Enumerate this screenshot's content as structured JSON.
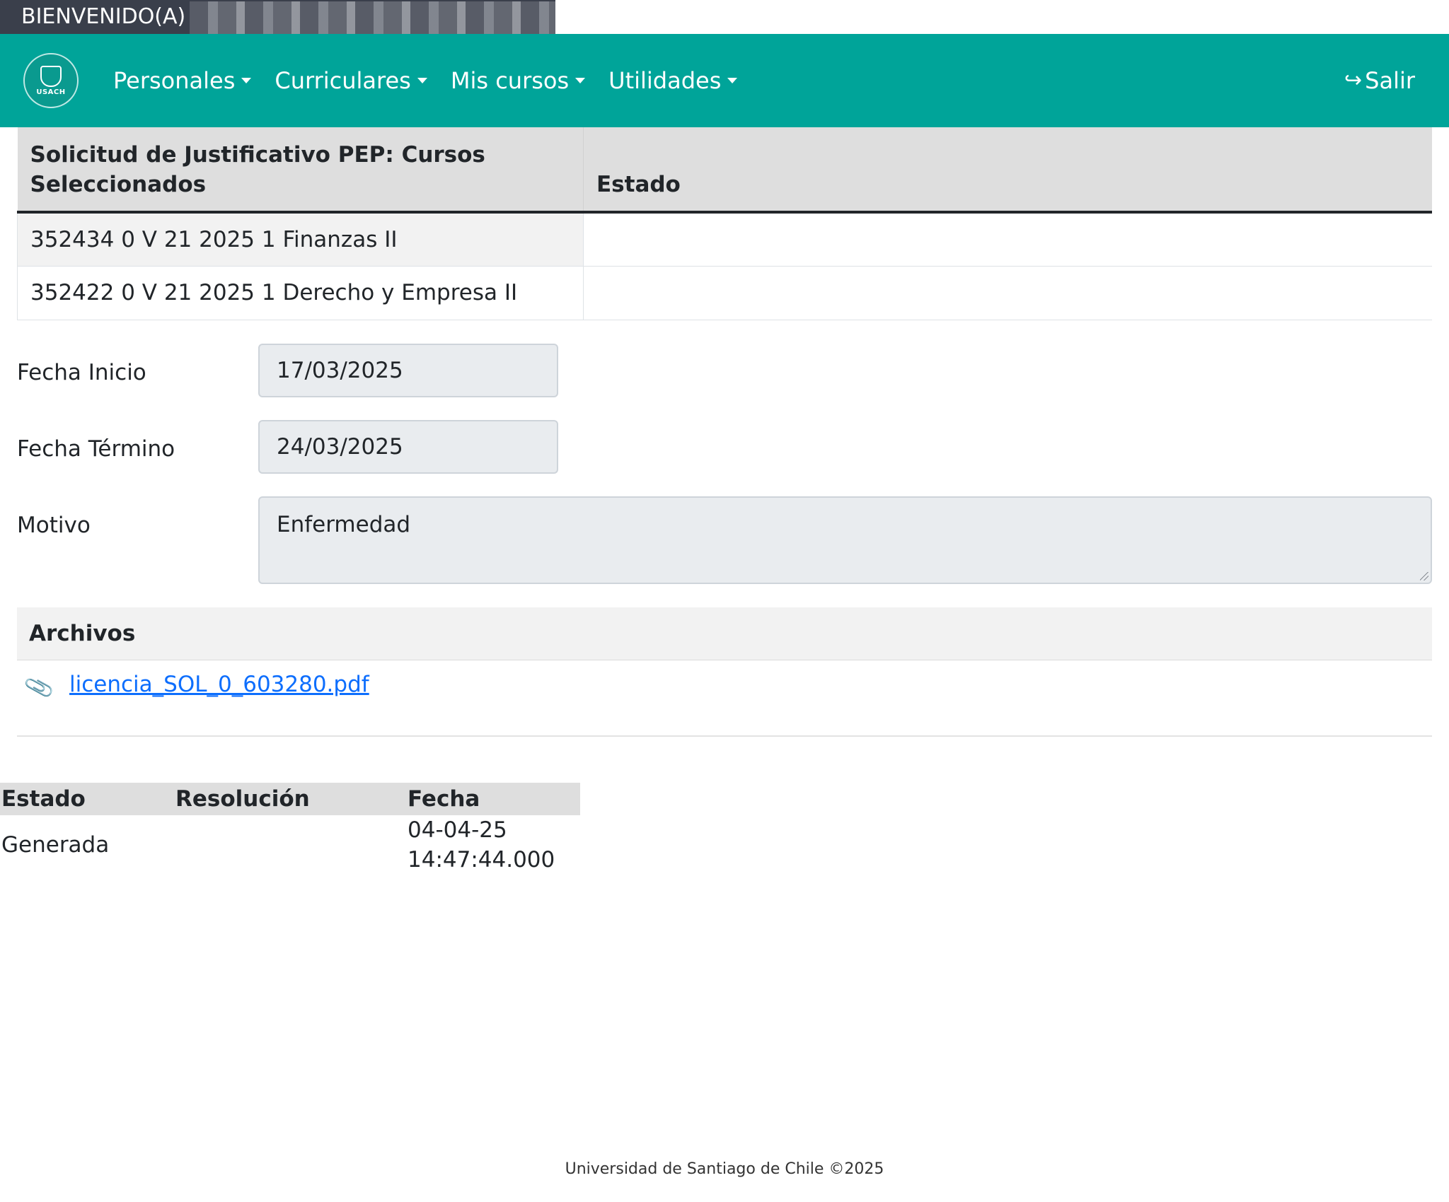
{
  "welcome": {
    "label": "BIENVENIDO(A)"
  },
  "navbar": {
    "logo_text": "USACH",
    "menu": [
      {
        "label": "Personales"
      },
      {
        "label": "Curriculares"
      },
      {
        "label": "Mis cursos"
      },
      {
        "label": "Utilidades"
      }
    ],
    "logout_label": "Salir",
    "color": "#00a499"
  },
  "courses_table": {
    "headers": [
      "Solicitud de Justificativo PEP: Cursos Seleccionados",
      "Estado"
    ],
    "rows": [
      {
        "course": "352434 0 V 21 2025 1 Finanzas II",
        "estado": ""
      },
      {
        "course": "352422 0 V 21 2025 1 Derecho y Empresa II",
        "estado": ""
      }
    ]
  },
  "form": {
    "fecha_inicio_label": "Fecha Inicio",
    "fecha_inicio_value": "17/03/2025",
    "fecha_termino_label": "Fecha Término",
    "fecha_termino_value": "24/03/2025",
    "motivo_label": "Motivo",
    "motivo_value": "Enfermedad"
  },
  "archivos": {
    "title": "Archivos",
    "files": [
      {
        "name": "licencia_SOL_0_603280.pdf"
      }
    ]
  },
  "history_table": {
    "headers": [
      "Estado",
      "Resolución",
      "Fecha"
    ],
    "rows": [
      {
        "estado": "Generada",
        "resolucion": "",
        "fecha_date": "04-04-25",
        "fecha_time": "14:47:44.000"
      }
    ]
  },
  "footer": {
    "text": "Universidad de Santiago de Chile ©2025"
  }
}
